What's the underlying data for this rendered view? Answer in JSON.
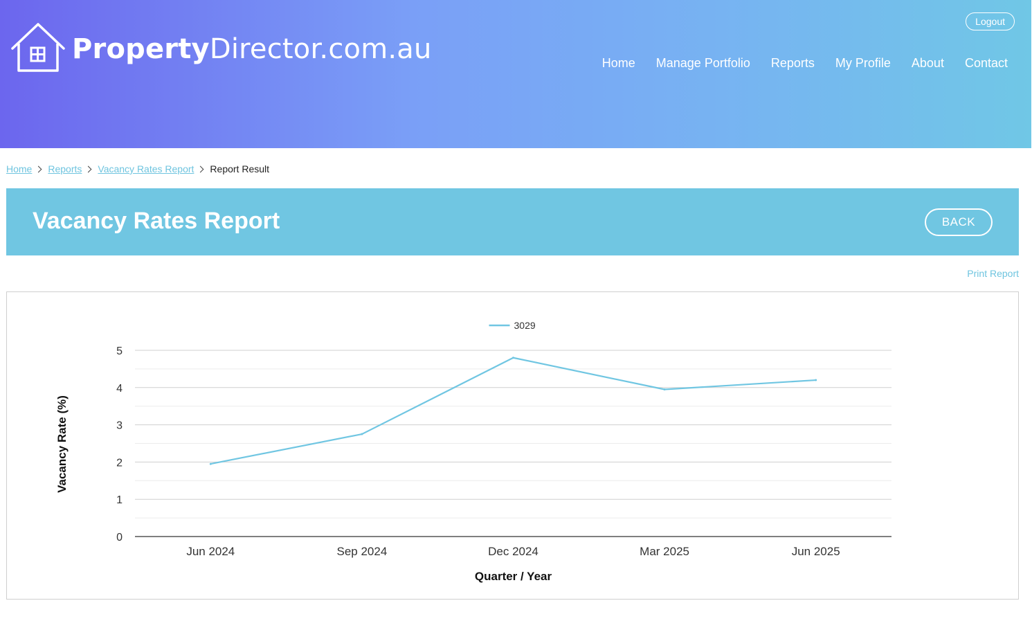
{
  "header": {
    "brand_bold": "Property",
    "brand_rest": "Director.com.au",
    "logout_label": "Logout",
    "nav": [
      "Home",
      "Manage Portfolio",
      "Reports",
      "My Profile",
      "About",
      "Contact"
    ],
    "colors": {
      "gradient_start": "#6c66ee",
      "gradient_end": "#70c7e6"
    }
  },
  "breadcrumb": {
    "items": [
      "Home",
      "Reports",
      "Vacancy Rates Report"
    ],
    "current": "Report Result"
  },
  "banner": {
    "title": "Vacancy Rates Report",
    "back_label": "BACK",
    "color": "#70c6e2"
  },
  "print_label": "Print Report",
  "chart_data": {
    "type": "line",
    "categories": [
      "Jun 2024",
      "Sep 2024",
      "Dec 2024",
      "Mar 2025",
      "Jun 2025"
    ],
    "series": [
      {
        "name": "3029",
        "values": [
          1.95,
          2.75,
          4.8,
          3.95,
          4.2
        ],
        "color": "#70c6e2"
      }
    ],
    "xlabel": "Quarter / Year",
    "ylabel": "Vacancy Rate (%)",
    "ylim": [
      0,
      5
    ],
    "yticks": [
      0,
      1,
      2,
      3,
      4,
      5
    ],
    "grid": true,
    "legend": "top-center"
  }
}
